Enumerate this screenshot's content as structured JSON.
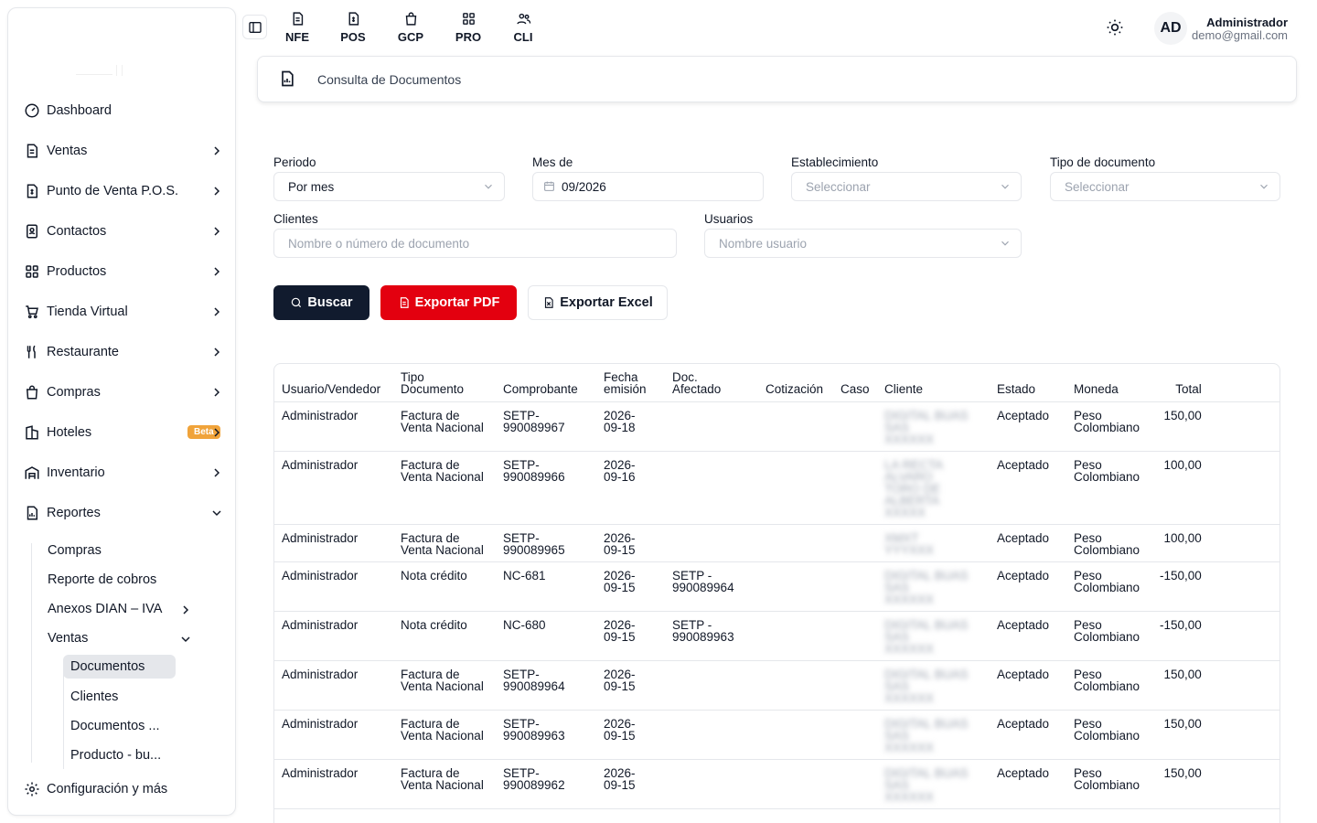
{
  "top_tabs": [
    {
      "label": "NFE",
      "icon": "file-text-icon"
    },
    {
      "label": "POS",
      "icon": "file-dollar-icon"
    },
    {
      "label": "GCP",
      "icon": "shopping-bag-icon"
    },
    {
      "label": "PRO",
      "icon": "grid-icon"
    },
    {
      "label": "CLI",
      "icon": "users-icon"
    }
  ],
  "user": {
    "initials": "AD",
    "name": "Administrador",
    "email": "demo@gmail.com"
  },
  "sidebar": {
    "items": [
      {
        "label": "Dashboard",
        "icon": "gauge-icon"
      },
      {
        "label": "Ventas",
        "icon": "file-icon"
      },
      {
        "label": "Punto de Venta P.O.S.",
        "icon": "receipt-dollar-icon"
      },
      {
        "label": "Contactos",
        "icon": "contacts-icon"
      },
      {
        "label": "Productos",
        "icon": "grid-icon"
      },
      {
        "label": "Tienda Virtual",
        "icon": "cart-icon"
      },
      {
        "label": "Restaurante",
        "icon": "utensils-icon"
      },
      {
        "label": "Compras",
        "icon": "shopping-bag-icon"
      },
      {
        "label": "Hoteles",
        "icon": "building-icon",
        "badge": "Beta"
      },
      {
        "label": "Inventario",
        "icon": "warehouse-icon"
      },
      {
        "label": "Reportes",
        "icon": "chart-file-icon"
      }
    ],
    "reportes_sub": [
      "Compras",
      "Reporte de cobros",
      "Anexos DIAN – IVA",
      "Ventas"
    ],
    "ventas_sub": [
      "Documentos",
      "Clientes",
      "Documentos ...",
      "Producto - bu..."
    ],
    "footer": {
      "label": "Configuración y más",
      "icon": "gear-icon"
    }
  },
  "breadcrumb": {
    "title": "Consulta de Documentos",
    "icon": "chart-file-icon"
  },
  "filters": {
    "periodo": {
      "label": "Periodo",
      "value": "Por mes"
    },
    "mes": {
      "label": "Mes de",
      "value": "09/2026"
    },
    "establecimiento": {
      "label": "Establecimiento",
      "placeholder": "Seleccionar"
    },
    "tipo_documento": {
      "label": "Tipo de documento",
      "placeholder": "Seleccionar"
    },
    "clientes": {
      "label": "Clientes",
      "placeholder": "Nombre o número de documento"
    },
    "usuarios": {
      "label": "Usuarios",
      "placeholder": "Nombre usuario"
    }
  },
  "buttons": {
    "buscar": "Buscar",
    "pdf": "Exportar PDF",
    "excel": "Exportar Excel"
  },
  "table": {
    "headers": {
      "usuario": "Usuario/Vendedor",
      "tipo1": "Tipo",
      "tipo2": "Documento",
      "comprobante": "Comprobante",
      "fecha1": "Fecha",
      "fecha2": "emisión",
      "doc1": "Doc.",
      "doc2": "Afectado",
      "cotizacion": "Cotización",
      "caso": "Caso",
      "cliente": "Cliente",
      "estado": "Estado",
      "moneda": "Moneda",
      "total": "Total"
    },
    "rows": [
      {
        "usuario": "Administrador",
        "tipo": [
          "Factura de",
          "Venta Nacional"
        ],
        "comprobante": [
          "SETP-",
          "990089967"
        ],
        "fecha": [
          "2026-",
          "09-18"
        ],
        "afectado": [],
        "cliente": [
          "DIGITAL BUAS",
          "SAS",
          "XXXXXX"
        ],
        "estado": "Aceptado",
        "moneda": [
          "Peso",
          "Colombiano"
        ],
        "total": "150,00"
      },
      {
        "usuario": "Administrador",
        "tipo": [
          "Factura de",
          "Venta Nacional"
        ],
        "comprobante": [
          "SETP-",
          "990089966"
        ],
        "fecha": [
          "2026-",
          "09-16"
        ],
        "afectado": [],
        "cliente": [
          "LA RECTA",
          "ALVARO",
          "TORO DE",
          "ALBERTA",
          "XXXXX"
        ],
        "estado": "Aceptado",
        "moneda": [
          "Peso",
          "Colombiano"
        ],
        "total": "100,00"
      },
      {
        "usuario": "Administrador",
        "tipo": [
          "Factura de",
          "Venta Nacional"
        ],
        "comprobante": [
          "SETP-",
          "990089965"
        ],
        "fecha": [
          "2026-",
          "09-15"
        ],
        "afectado": [],
        "cliente": [
          "XMXT",
          "YYYXXX"
        ],
        "estado": "Aceptado",
        "moneda": [
          "Peso",
          "Colombiano"
        ],
        "total": "100,00"
      },
      {
        "usuario": "Administrador",
        "tipo": [
          "Nota crédito"
        ],
        "comprobante": [
          "NC-681"
        ],
        "fecha": [
          "2026-",
          "09-15"
        ],
        "afectado": [
          "SETP -",
          "990089964"
        ],
        "cliente": [
          "DIGITAL BUAS",
          "SAS",
          "XXXXXX"
        ],
        "estado": "Aceptado",
        "moneda": [
          "Peso",
          "Colombiano"
        ],
        "total": "-150,00"
      },
      {
        "usuario": "Administrador",
        "tipo": [
          "Nota crédito"
        ],
        "comprobante": [
          "NC-680"
        ],
        "fecha": [
          "2026-",
          "09-15"
        ],
        "afectado": [
          "SETP -",
          "990089963"
        ],
        "cliente": [
          "DIGITAL BUAS",
          "SAS",
          "XXXXXX"
        ],
        "estado": "Aceptado",
        "moneda": [
          "Peso",
          "Colombiano"
        ],
        "total": "-150,00"
      },
      {
        "usuario": "Administrador",
        "tipo": [
          "Factura de",
          "Venta Nacional"
        ],
        "comprobante": [
          "SETP-",
          "990089964"
        ],
        "fecha": [
          "2026-",
          "09-15"
        ],
        "afectado": [],
        "cliente": [
          "DIGITAL BUAS",
          "SAS",
          "XXXXXX"
        ],
        "estado": "Aceptado",
        "moneda": [
          "Peso",
          "Colombiano"
        ],
        "total": "150,00"
      },
      {
        "usuario": "Administrador",
        "tipo": [
          "Factura de",
          "Venta Nacional"
        ],
        "comprobante": [
          "SETP-",
          "990089963"
        ],
        "fecha": [
          "2026-",
          "09-15"
        ],
        "afectado": [],
        "cliente": [
          "DIGITAL BUAS",
          "SAS",
          "XXXXXX"
        ],
        "estado": "Aceptado",
        "moneda": [
          "Peso",
          "Colombiano"
        ],
        "total": "150,00"
      },
      {
        "usuario": "Administrador",
        "tipo": [
          "Factura de",
          "Venta Nacional"
        ],
        "comprobante": [
          "SETP-",
          "990089962"
        ],
        "fecha": [
          "2026-",
          "09-15"
        ],
        "afectado": [],
        "cliente": [
          "DIGITAL BUAS",
          "SAS",
          "XXXXXX"
        ],
        "estado": "Aceptado",
        "moneda": [
          "Peso",
          "Colombiano"
        ],
        "total": "150,00"
      }
    ]
  }
}
